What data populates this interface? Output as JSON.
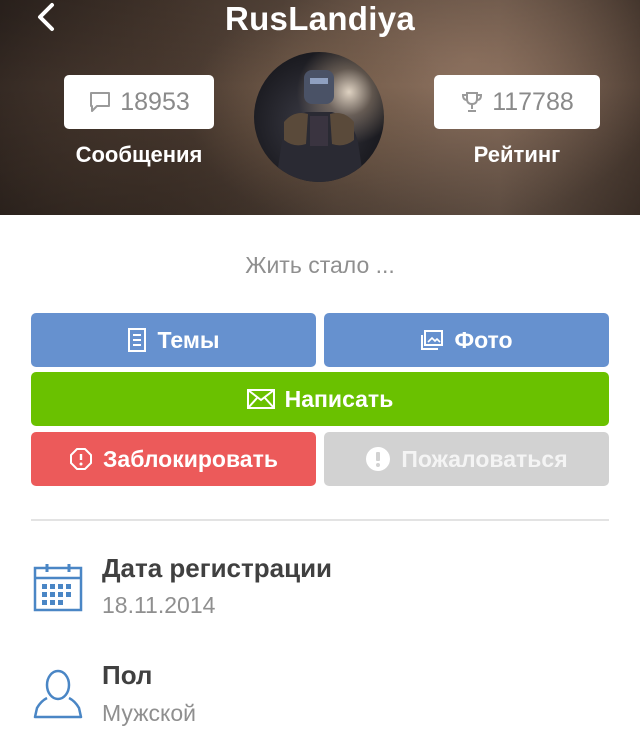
{
  "header": {
    "title": "RusLandiya",
    "messages": {
      "count": "18953",
      "label": "Сообщения",
      "icon": "speech-bubble-icon"
    },
    "rating": {
      "count": "117788",
      "label": "Рейтинг",
      "icon": "trophy-icon"
    }
  },
  "status_text": "Жить стало ...",
  "buttons": {
    "topics": "Темы",
    "photo": "Фото",
    "write": "Написать",
    "block": "Заблокировать",
    "report": "Пожаловаться"
  },
  "info": [
    {
      "title": "Дата регистрации",
      "value": "18.11.2014",
      "icon": "calendar-icon"
    },
    {
      "title": "Пол",
      "value": "Мужской",
      "icon": "person-icon"
    }
  ],
  "colors": {
    "primary_blue": "#6691cf",
    "write_green": "#6ac100",
    "block_red": "#ec5a5a",
    "report_gray": "#d2d2d2",
    "icon_blue": "#4a86c5"
  }
}
